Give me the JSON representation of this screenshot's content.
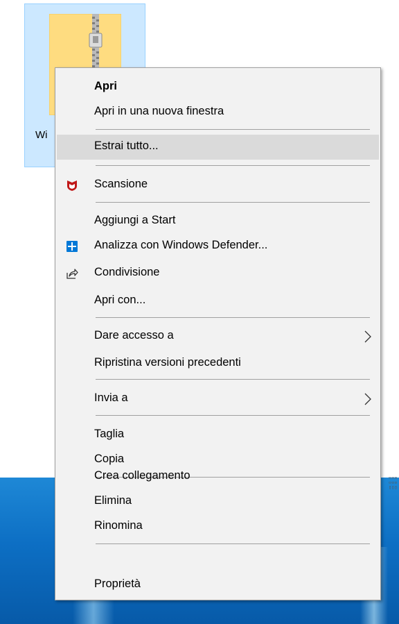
{
  "desktop": {
    "icon_label": "Wi"
  },
  "context_menu": {
    "items": [
      {
        "label": "Apri",
        "bold": true
      },
      {
        "label": "Apri in una nuova finestra"
      },
      {
        "label": "Estrai tutto...",
        "highlighted": true
      },
      {
        "label": "Scansione",
        "icon": "mcafee-shield-icon"
      },
      {
        "label": "Aggiungi a Start"
      },
      {
        "label": "Analizza con Windows Defender...",
        "icon": "windows-defender-icon"
      },
      {
        "label": "Condivisione",
        "icon": "share-icon"
      },
      {
        "label": "Apri con..."
      },
      {
        "label": "Dare accesso a",
        "submenu": true
      },
      {
        "label": "Ripristina versioni precedenti"
      },
      {
        "label": "Invia a",
        "submenu": true
      },
      {
        "label": "Taglia"
      },
      {
        "label": "Copia"
      },
      {
        "label": "Crea collegamento"
      },
      {
        "label": "Elimina"
      },
      {
        "label": "Rinomina"
      },
      {
        "label": "Proprietà"
      }
    ]
  },
  "colors": {
    "menu_background": "#f2f2f2",
    "highlight": "#dadada",
    "selection": "#cce8ff",
    "mcafee_red": "#c01818",
    "defender_blue": "#0078d7",
    "wallpaper_blue": "#0d6fc4"
  }
}
